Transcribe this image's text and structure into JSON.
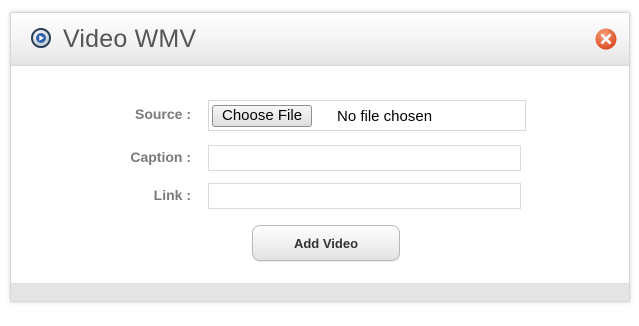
{
  "dialog": {
    "title": "Video WMV",
    "title_icon": "play-circle-icon",
    "close_icon": "close-icon",
    "accent_color": "#e8572a"
  },
  "form": {
    "source_label": "Source :",
    "choose_file_label": "Choose File",
    "file_status": "No file chosen",
    "caption_label": "Caption :",
    "caption_value": "",
    "link_label": "Link :",
    "link_value": "",
    "submit_label": "Add Video"
  }
}
